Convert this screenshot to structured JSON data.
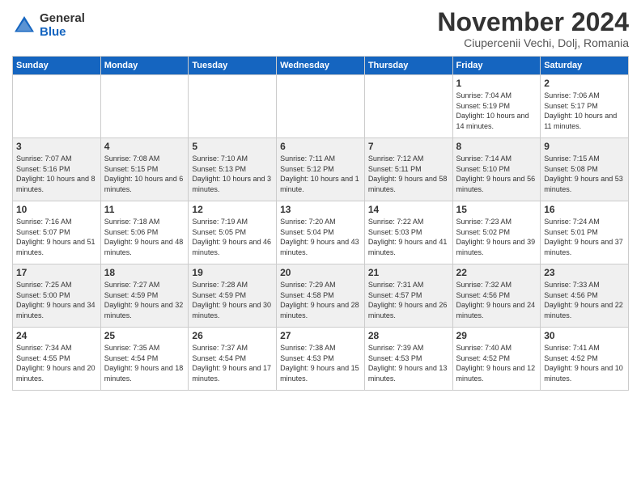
{
  "header": {
    "logo_general": "General",
    "logo_blue": "Blue",
    "month_title": "November 2024",
    "location": "Ciupercenii Vechi, Dolj, Romania"
  },
  "weekdays": [
    "Sunday",
    "Monday",
    "Tuesday",
    "Wednesday",
    "Thursday",
    "Friday",
    "Saturday"
  ],
  "weeks": [
    [
      {
        "day": "",
        "info": ""
      },
      {
        "day": "",
        "info": ""
      },
      {
        "day": "",
        "info": ""
      },
      {
        "day": "",
        "info": ""
      },
      {
        "day": "",
        "info": ""
      },
      {
        "day": "1",
        "info": "Sunrise: 7:04 AM\nSunset: 5:19 PM\nDaylight: 10 hours and 14 minutes."
      },
      {
        "day": "2",
        "info": "Sunrise: 7:06 AM\nSunset: 5:17 PM\nDaylight: 10 hours and 11 minutes."
      }
    ],
    [
      {
        "day": "3",
        "info": "Sunrise: 7:07 AM\nSunset: 5:16 PM\nDaylight: 10 hours and 8 minutes."
      },
      {
        "day": "4",
        "info": "Sunrise: 7:08 AM\nSunset: 5:15 PM\nDaylight: 10 hours and 6 minutes."
      },
      {
        "day": "5",
        "info": "Sunrise: 7:10 AM\nSunset: 5:13 PM\nDaylight: 10 hours and 3 minutes."
      },
      {
        "day": "6",
        "info": "Sunrise: 7:11 AM\nSunset: 5:12 PM\nDaylight: 10 hours and 1 minute."
      },
      {
        "day": "7",
        "info": "Sunrise: 7:12 AM\nSunset: 5:11 PM\nDaylight: 9 hours and 58 minutes."
      },
      {
        "day": "8",
        "info": "Sunrise: 7:14 AM\nSunset: 5:10 PM\nDaylight: 9 hours and 56 minutes."
      },
      {
        "day": "9",
        "info": "Sunrise: 7:15 AM\nSunset: 5:08 PM\nDaylight: 9 hours and 53 minutes."
      }
    ],
    [
      {
        "day": "10",
        "info": "Sunrise: 7:16 AM\nSunset: 5:07 PM\nDaylight: 9 hours and 51 minutes."
      },
      {
        "day": "11",
        "info": "Sunrise: 7:18 AM\nSunset: 5:06 PM\nDaylight: 9 hours and 48 minutes."
      },
      {
        "day": "12",
        "info": "Sunrise: 7:19 AM\nSunset: 5:05 PM\nDaylight: 9 hours and 46 minutes."
      },
      {
        "day": "13",
        "info": "Sunrise: 7:20 AM\nSunset: 5:04 PM\nDaylight: 9 hours and 43 minutes."
      },
      {
        "day": "14",
        "info": "Sunrise: 7:22 AM\nSunset: 5:03 PM\nDaylight: 9 hours and 41 minutes."
      },
      {
        "day": "15",
        "info": "Sunrise: 7:23 AM\nSunset: 5:02 PM\nDaylight: 9 hours and 39 minutes."
      },
      {
        "day": "16",
        "info": "Sunrise: 7:24 AM\nSunset: 5:01 PM\nDaylight: 9 hours and 37 minutes."
      }
    ],
    [
      {
        "day": "17",
        "info": "Sunrise: 7:25 AM\nSunset: 5:00 PM\nDaylight: 9 hours and 34 minutes."
      },
      {
        "day": "18",
        "info": "Sunrise: 7:27 AM\nSunset: 4:59 PM\nDaylight: 9 hours and 32 minutes."
      },
      {
        "day": "19",
        "info": "Sunrise: 7:28 AM\nSunset: 4:59 PM\nDaylight: 9 hours and 30 minutes."
      },
      {
        "day": "20",
        "info": "Sunrise: 7:29 AM\nSunset: 4:58 PM\nDaylight: 9 hours and 28 minutes."
      },
      {
        "day": "21",
        "info": "Sunrise: 7:31 AM\nSunset: 4:57 PM\nDaylight: 9 hours and 26 minutes."
      },
      {
        "day": "22",
        "info": "Sunrise: 7:32 AM\nSunset: 4:56 PM\nDaylight: 9 hours and 24 minutes."
      },
      {
        "day": "23",
        "info": "Sunrise: 7:33 AM\nSunset: 4:56 PM\nDaylight: 9 hours and 22 minutes."
      }
    ],
    [
      {
        "day": "24",
        "info": "Sunrise: 7:34 AM\nSunset: 4:55 PM\nDaylight: 9 hours and 20 minutes."
      },
      {
        "day": "25",
        "info": "Sunrise: 7:35 AM\nSunset: 4:54 PM\nDaylight: 9 hours and 18 minutes."
      },
      {
        "day": "26",
        "info": "Sunrise: 7:37 AM\nSunset: 4:54 PM\nDaylight: 9 hours and 17 minutes."
      },
      {
        "day": "27",
        "info": "Sunrise: 7:38 AM\nSunset: 4:53 PM\nDaylight: 9 hours and 15 minutes."
      },
      {
        "day": "28",
        "info": "Sunrise: 7:39 AM\nSunset: 4:53 PM\nDaylight: 9 hours and 13 minutes."
      },
      {
        "day": "29",
        "info": "Sunrise: 7:40 AM\nSunset: 4:52 PM\nDaylight: 9 hours and 12 minutes."
      },
      {
        "day": "30",
        "info": "Sunrise: 7:41 AM\nSunset: 4:52 PM\nDaylight: 9 hours and 10 minutes."
      }
    ]
  ]
}
